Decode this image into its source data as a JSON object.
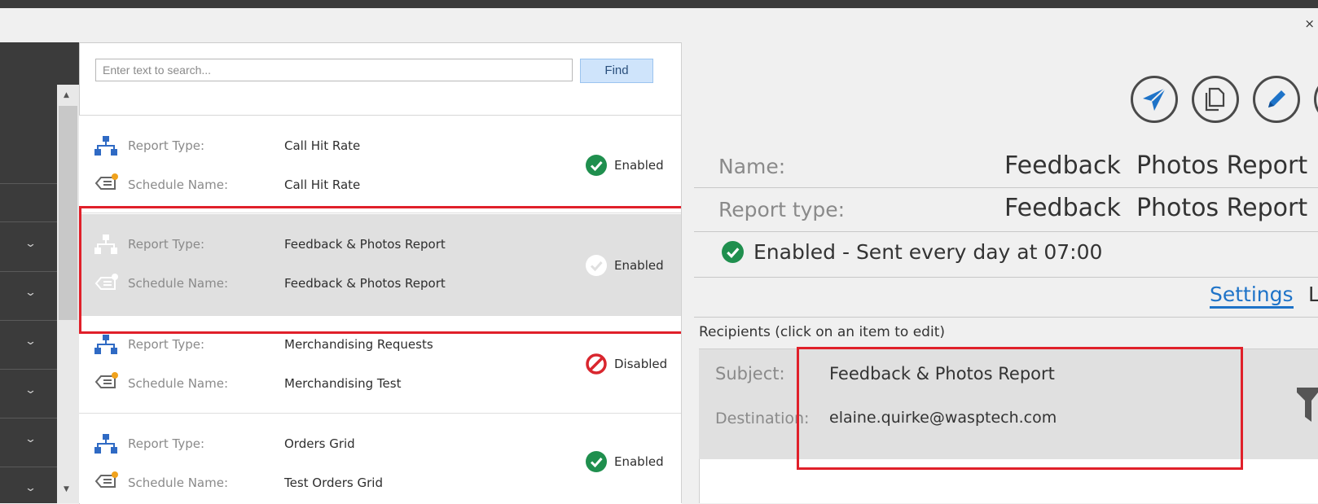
{
  "window": {
    "close_glyph": "×"
  },
  "search": {
    "placeholder": "Enter text to search...",
    "find_label": "Find"
  },
  "list": {
    "items": [
      {
        "report_type_label": "Report Type:",
        "report_type": "Call Hit Rate",
        "schedule_name_label": "Schedule Name:",
        "schedule_name": "Call Hit Rate",
        "status": "Enabled",
        "status_icon": "check-circle-icon"
      },
      {
        "report_type_label": "Report Type:",
        "report_type": "Feedback & Photos Report",
        "schedule_name_label": "Schedule Name:",
        "schedule_name": "Feedback & Photos Report",
        "status": "Enabled",
        "status_icon": "check-circle-icon",
        "selected": true
      },
      {
        "report_type_label": "Report Type:",
        "report_type": "Merchandising Requests",
        "schedule_name_label": "Schedule Name:",
        "schedule_name": "Merchandising Test",
        "status": "Disabled",
        "status_icon": "disabled-icon"
      },
      {
        "report_type_label": "Report Type:",
        "report_type": "Orders Grid",
        "schedule_name_label": "Schedule Name:",
        "schedule_name": "Test Orders Grid",
        "status": "Enabled",
        "status_icon": "check-circle-icon"
      }
    ]
  },
  "detail": {
    "actions": [
      "send-icon",
      "copy-icon",
      "edit-icon"
    ],
    "name_label": "Name:",
    "name_value": "Feedback  Photos Report",
    "report_type_label": "Report type:",
    "report_type_value": "Feedback  Photos Report",
    "status_text": "Enabled - Sent every day at 07:00",
    "tabs": {
      "settings": "Settings",
      "second_partial": "Lc"
    },
    "recipients_title": "Recipients (click on an item to edit)",
    "recipient": {
      "subject_label": "Subject:",
      "subject_value": "Feedback & Photos Report",
      "destination_label": "Destination:",
      "destination_value": "elaine.quirke@wasptech.com"
    }
  },
  "colors": {
    "accent": "#1e73c8",
    "enabled": "#1f8f4e",
    "disabled": "#d9262e",
    "highlight": "#e0202a"
  }
}
